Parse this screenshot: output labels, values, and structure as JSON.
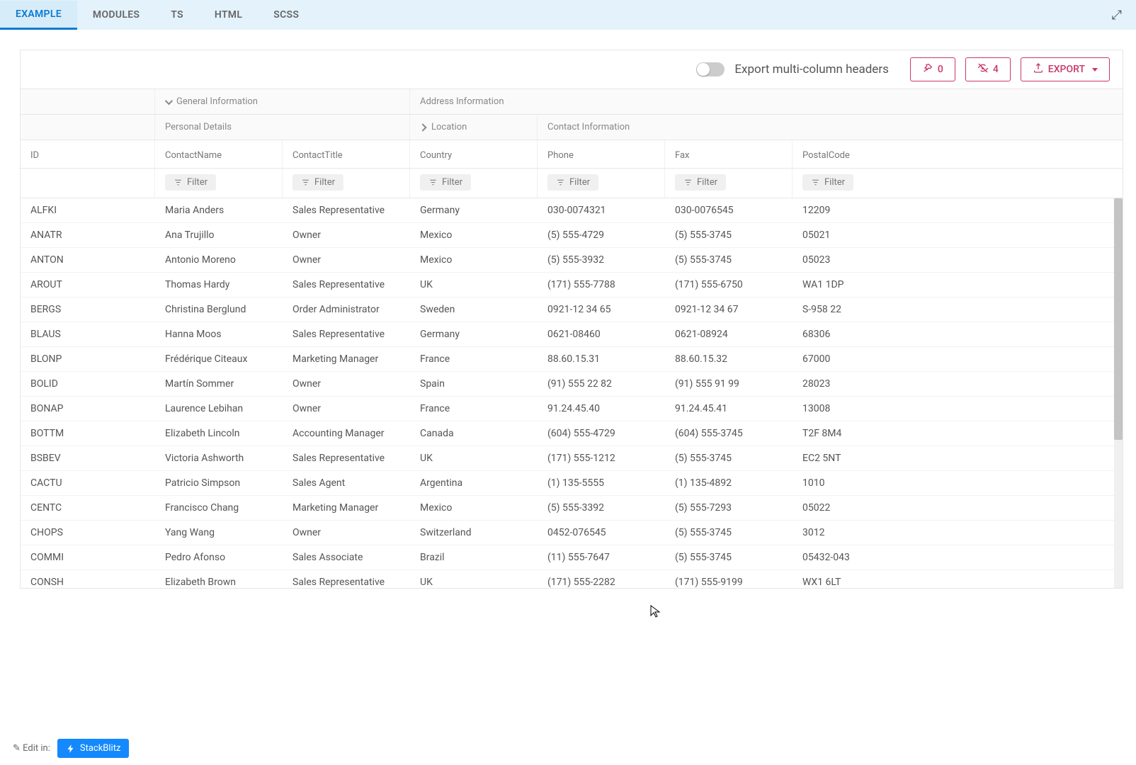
{
  "tabs": [
    "EXAMPLE",
    "MODULES",
    "TS",
    "HTML",
    "SCSS"
  ],
  "activeTab": 0,
  "toolbar": {
    "switchLabel": "Export multi-column headers",
    "pinnedCount": "0",
    "hiddenCount": "4",
    "exportLabel": "EXPORT"
  },
  "groupHeaders": {
    "row1": {
      "blank": "",
      "general": "General Information",
      "address": "Address Information"
    },
    "row2": {
      "personal": "Personal Details",
      "location": "Location",
      "contact": "Contact Information"
    }
  },
  "columns": [
    "ID",
    "ContactName",
    "ContactTitle",
    "Country",
    "Phone",
    "Fax",
    "PostalCode"
  ],
  "filterLabel": "Filter",
  "rows": [
    [
      "ALFKI",
      "Maria Anders",
      "Sales Representative",
      "Germany",
      "030-0074321",
      "030-0076545",
      "12209"
    ],
    [
      "ANATR",
      "Ana Trujillo",
      "Owner",
      "Mexico",
      "(5) 555-4729",
      "(5) 555-3745",
      "05021"
    ],
    [
      "ANTON",
      "Antonio Moreno",
      "Owner",
      "Mexico",
      "(5) 555-3932",
      "(5) 555-3745",
      "05023"
    ],
    [
      "AROUT",
      "Thomas Hardy",
      "Sales Representative",
      "UK",
      "(171) 555-7788",
      "(171) 555-6750",
      "WA1 1DP"
    ],
    [
      "BERGS",
      "Christina Berglund",
      "Order Administrator",
      "Sweden",
      "0921-12 34 65",
      "0921-12 34 67",
      "S-958 22"
    ],
    [
      "BLAUS",
      "Hanna Moos",
      "Sales Representative",
      "Germany",
      "0621-08460",
      "0621-08924",
      "68306"
    ],
    [
      "BLONP",
      "Frédérique Citeaux",
      "Marketing Manager",
      "France",
      "88.60.15.31",
      "88.60.15.32",
      "67000"
    ],
    [
      "BOLID",
      "Martín Sommer",
      "Owner",
      "Spain",
      "(91) 555 22 82",
      "(91) 555 91 99",
      "28023"
    ],
    [
      "BONAP",
      "Laurence Lebihan",
      "Owner",
      "France",
      "91.24.45.40",
      "91.24.45.41",
      "13008"
    ],
    [
      "BOTTM",
      "Elizabeth Lincoln",
      "Accounting Manager",
      "Canada",
      "(604) 555-4729",
      "(604) 555-3745",
      "T2F 8M4"
    ],
    [
      "BSBEV",
      "Victoria Ashworth",
      "Sales Representative",
      "UK",
      "(171) 555-1212",
      "(5) 555-3745",
      "EC2 5NT"
    ],
    [
      "CACTU",
      "Patricio Simpson",
      "Sales Agent",
      "Argentina",
      "(1) 135-5555",
      "(1) 135-4892",
      "1010"
    ],
    [
      "CENTC",
      "Francisco Chang",
      "Marketing Manager",
      "Mexico",
      "(5) 555-3392",
      "(5) 555-7293",
      "05022"
    ],
    [
      "CHOPS",
      "Yang Wang",
      "Owner",
      "Switzerland",
      "0452-076545",
      "(5) 555-3745",
      "3012"
    ],
    [
      "COMMI",
      "Pedro Afonso",
      "Sales Associate",
      "Brazil",
      "(11) 555-7647",
      "(5) 555-3745",
      "05432-043"
    ],
    [
      "CONSH",
      "Elizabeth Brown",
      "Sales Representative",
      "UK",
      "(171) 555-2282",
      "(171) 555-9199",
      "WX1 6LT"
    ]
  ],
  "footer": {
    "editIn": "Edit in:",
    "stackblitz": "StackBlitz"
  }
}
